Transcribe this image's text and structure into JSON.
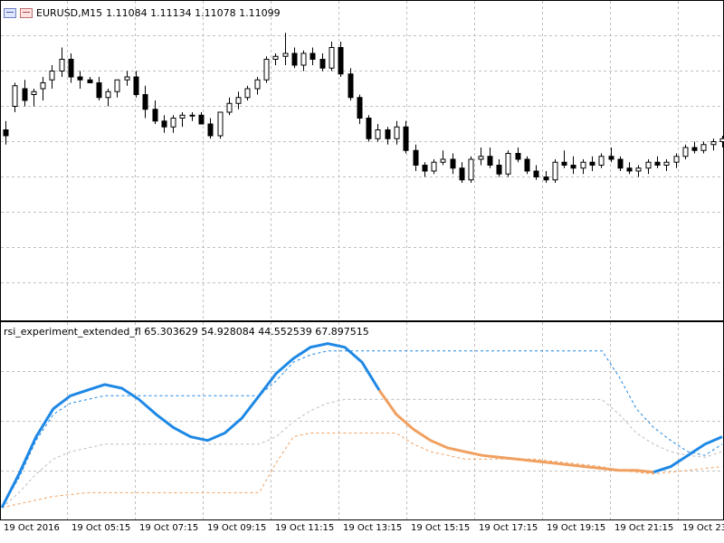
{
  "window": {
    "symbol_label": "EURUSD,M15",
    "ohlc_text": "1.11084 1.11134 1.11078 1.11099",
    "icons": [
      "chart-window-icon",
      "chart-window-icon-alt"
    ]
  },
  "indicator": {
    "name": "rsi_experiment_extended_fl",
    "values_text": "65.303629 54.928084 44.552539 67.897515"
  },
  "colors": {
    "background": "#ffffff",
    "grid": "#c0c0c0",
    "candle": "#000000",
    "rsi_main": "#1e88e5",
    "rsi_upper": "#1e88e5",
    "rsi_mid": "#bdbdbd",
    "rsi_lower": "#f0a060",
    "rsi_main_low": "#f0a060"
  },
  "time_axis": {
    "labels": [
      "19 Oct 2016",
      "19 Oct 05:15",
      "19 Oct 07:15",
      "19 Oct 09:15",
      "19 Oct 11:15",
      "19 Oct 13:15",
      "19 Oct 15:15",
      "19 Oct 17:15",
      "19 Oct 19:15",
      "19 Oct 21:15",
      "19 Oct 23"
    ]
  },
  "chart_data": [
    {
      "type": "candlestick",
      "title": "EURUSD,M15",
      "x": "bar index (15-minute bars)",
      "ylim": [
        0,
        100
      ],
      "grid": true,
      "candles": [
        [
          62,
          65,
          57,
          60
        ],
        [
          70,
          78,
          68,
          77
        ],
        [
          76,
          79,
          70,
          72
        ],
        [
          74,
          76,
          70,
          75
        ],
        [
          76,
          80,
          72,
          78
        ],
        [
          79,
          84,
          76,
          82
        ],
        [
          82,
          90,
          80,
          86
        ],
        [
          86,
          88,
          78,
          80
        ],
        [
          80,
          82,
          76,
          79
        ],
        [
          79,
          80,
          78,
          78
        ],
        [
          78,
          80,
          72,
          73
        ],
        [
          73,
          76,
          70,
          75
        ],
        [
          75,
          79,
          73,
          79
        ],
        [
          79,
          82,
          77,
          80
        ],
        [
          80,
          82,
          73,
          74
        ],
        [
          74,
          77,
          66,
          69
        ],
        [
          69,
          72,
          64,
          65
        ],
        [
          65,
          67,
          61,
          63
        ],
        [
          63,
          67,
          61,
          66
        ],
        [
          66,
          68,
          63,
          67
        ],
        [
          67,
          68,
          65,
          67
        ],
        [
          67,
          68,
          64,
          64
        ],
        [
          64,
          66,
          59,
          60
        ],
        [
          60,
          68,
          59,
          68
        ],
        [
          68,
          73,
          67,
          71
        ],
        [
          71,
          75,
          69,
          73
        ],
        [
          73,
          77,
          72,
          76
        ],
        [
          76,
          80,
          74,
          79
        ],
        [
          79,
          87,
          78,
          86
        ],
        [
          86,
          88,
          84,
          87
        ],
        [
          87,
          95,
          84,
          88
        ],
        [
          88,
          90,
          83,
          84
        ],
        [
          84,
          89,
          82,
          88
        ],
        [
          88,
          90,
          84,
          86
        ],
        [
          86,
          88,
          82,
          83
        ],
        [
          83,
          92,
          82,
          90
        ],
        [
          90,
          92,
          80,
          81
        ],
        [
          81,
          83,
          72,
          73
        ],
        [
          73,
          74,
          64,
          66
        ],
        [
          66,
          67,
          58,
          59
        ],
        [
          59,
          64,
          58,
          62
        ],
        [
          62,
          63,
          57,
          59
        ],
        [
          59,
          65,
          57,
          63
        ],
        [
          63,
          65,
          54,
          55
        ],
        [
          55,
          57,
          48,
          50
        ],
        [
          50,
          51,
          46,
          48
        ],
        [
          48,
          52,
          47,
          51
        ],
        [
          51,
          55,
          50,
          52
        ],
        [
          52,
          54,
          47,
          49
        ],
        [
          49,
          51,
          44,
          45
        ],
        [
          45,
          53,
          44,
          52
        ],
        [
          52,
          56,
          50,
          53
        ],
        [
          53,
          56,
          49,
          50
        ],
        [
          50,
          52,
          46,
          47
        ],
        [
          47,
          55,
          46,
          54
        ],
        [
          54,
          56,
          51,
          52
        ],
        [
          52,
          53,
          47,
          48
        ],
        [
          48,
          50,
          45,
          46
        ],
        [
          46,
          48,
          44,
          45
        ],
        [
          45,
          52,
          44,
          51
        ],
        [
          51,
          55,
          49,
          50
        ],
        [
          50,
          53,
          47,
          49
        ],
        [
          49,
          52,
          47,
          51
        ],
        [
          51,
          53,
          48,
          50
        ],
        [
          50,
          54,
          49,
          53
        ],
        [
          53,
          56,
          51,
          52
        ],
        [
          52,
          53,
          48,
          49
        ],
        [
          49,
          51,
          47,
          48
        ],
        [
          48,
          50,
          46,
          49
        ],
        [
          49,
          52,
          47,
          51
        ],
        [
          51,
          53,
          49,
          50
        ],
        [
          50,
          52,
          48,
          51
        ],
        [
          51,
          54,
          49,
          53
        ],
        [
          53,
          57,
          52,
          56
        ],
        [
          56,
          58,
          54,
          55
        ],
        [
          55,
          58,
          54,
          57
        ],
        [
          57,
          59,
          55,
          58
        ],
        [
          58,
          60,
          56,
          59
        ]
      ]
    },
    {
      "type": "line",
      "title": "rsi_experiment_extended_fl",
      "ylim": [
        0,
        100
      ],
      "grid": true,
      "series": [
        {
          "name": "rsi",
          "values": [
            2,
            20,
            40,
            55,
            62,
            65,
            68,
            66,
            60,
            52,
            45,
            40,
            38,
            42,
            50,
            62,
            74,
            82,
            88,
            90,
            88,
            80,
            65,
            52,
            44,
            38,
            34,
            32,
            30,
            29,
            28,
            27,
            26,
            25,
            24,
            23,
            22,
            22,
            21,
            24,
            30,
            36,
            40
          ]
        },
        {
          "name": "upper",
          "values": [
            2,
            18,
            38,
            52,
            58,
            60,
            62,
            62,
            62,
            62,
            62,
            62,
            62,
            62,
            62,
            62,
            70,
            80,
            84,
            86,
            86,
            86,
            86,
            86,
            86,
            86,
            86,
            86,
            86,
            86,
            86,
            86,
            86,
            86,
            86,
            86,
            72,
            55,
            45,
            38,
            32,
            30,
            36
          ]
        },
        {
          "name": "middle",
          "values": [
            2,
            10,
            20,
            28,
            32,
            34,
            36,
            36,
            36,
            36,
            36,
            36,
            36,
            36,
            36,
            36,
            40,
            48,
            54,
            58,
            60,
            60,
            60,
            60,
            60,
            60,
            60,
            60,
            60,
            60,
            60,
            60,
            60,
            60,
            60,
            60,
            52,
            42,
            36,
            32,
            30,
            29,
            32
          ]
        },
        {
          "name": "lower",
          "values": [
            2,
            4,
            6,
            8,
            9,
            10,
            10,
            10,
            10,
            10,
            10,
            10,
            10,
            10,
            10,
            10,
            26,
            40,
            42,
            42,
            42,
            42,
            42,
            42,
            36,
            32,
            30,
            28,
            28,
            28,
            28,
            28,
            27,
            26,
            25,
            24,
            22,
            21,
            20,
            21,
            22,
            23,
            24
          ]
        }
      ]
    }
  ]
}
